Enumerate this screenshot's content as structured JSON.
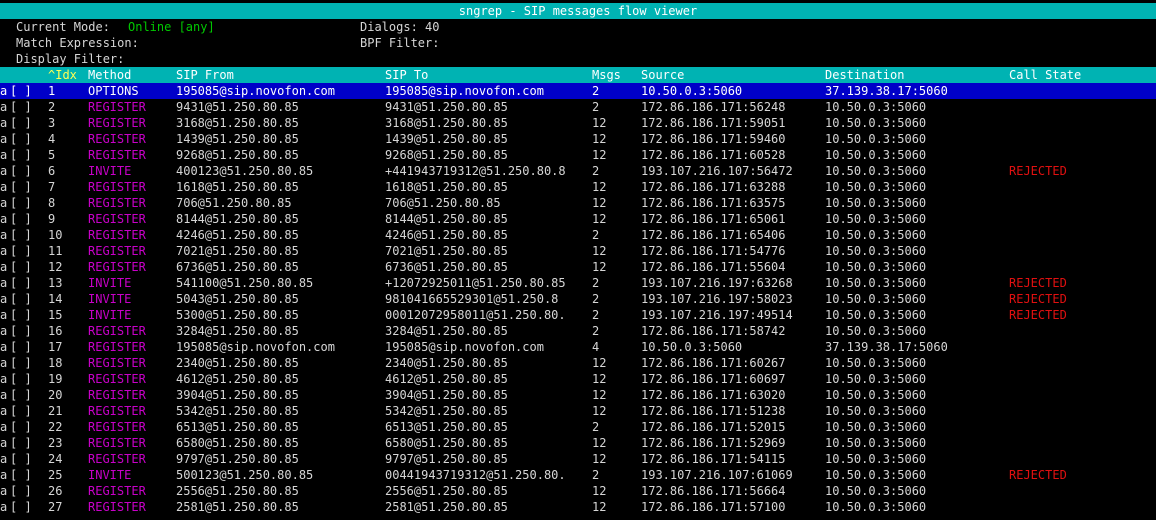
{
  "title": "sngrep - SIP messages flow viewer",
  "info": {
    "mode_label": "Current Mode:",
    "mode_value": "Online [any]",
    "dialogs_label": "Dialogs: 40",
    "match_label": "Match Expression:",
    "bpf_label": "BPF Filter:",
    "display_label": "Display Filter:"
  },
  "columns": {
    "idx": "^Idx",
    "method": "Method",
    "from": "SIP From",
    "to": "SIP To",
    "msgs": "Msgs",
    "source": "Source",
    "destination": "Destination",
    "state": "Call State"
  },
  "colors": {
    "header_bg": "#00b3b3",
    "selected_bg": "#0000c8",
    "method_color": "#c800c8",
    "rejected_color": "#e01010",
    "online_color": "#00c800"
  },
  "rows": [
    {
      "a": "a",
      "chk": "[ ]",
      "idx": "1",
      "method": "OPTIONS",
      "from": "195085@sip.novofon.com",
      "to": "195085@sip.novofon.com",
      "msgs": "2",
      "src": "10.50.0.3:5060",
      "dst": "37.139.38.17:5060",
      "state": ""
    },
    {
      "a": "a",
      "chk": "[ ]",
      "idx": "2",
      "method": "REGISTER",
      "from": "9431@51.250.80.85",
      "to": "9431@51.250.80.85",
      "msgs": "2",
      "src": "172.86.186.171:56248",
      "dst": "10.50.0.3:5060",
      "state": ""
    },
    {
      "a": "a",
      "chk": "[ ]",
      "idx": "3",
      "method": "REGISTER",
      "from": "3168@51.250.80.85",
      "to": "3168@51.250.80.85",
      "msgs": "12",
      "src": "172.86.186.171:59051",
      "dst": "10.50.0.3:5060",
      "state": ""
    },
    {
      "a": "a",
      "chk": "[ ]",
      "idx": "4",
      "method": "REGISTER",
      "from": "1439@51.250.80.85",
      "to": "1439@51.250.80.85",
      "msgs": "12",
      "src": "172.86.186.171:59460",
      "dst": "10.50.0.3:5060",
      "state": ""
    },
    {
      "a": "a",
      "chk": "[ ]",
      "idx": "5",
      "method": "REGISTER",
      "from": "9268@51.250.80.85",
      "to": "9268@51.250.80.85",
      "msgs": "12",
      "src": "172.86.186.171:60528",
      "dst": "10.50.0.3:5060",
      "state": ""
    },
    {
      "a": "a",
      "chk": "[ ]",
      "idx": "6",
      "method": "INVITE",
      "from": "400123@51.250.80.85",
      "to": "+441943719312@51.250.80.8",
      "msgs": "2",
      "src": "193.107.216.107:56472",
      "dst": "10.50.0.3:5060",
      "state": "REJECTED"
    },
    {
      "a": "a",
      "chk": "[ ]",
      "idx": "7",
      "method": "REGISTER",
      "from": "1618@51.250.80.85",
      "to": "1618@51.250.80.85",
      "msgs": "12",
      "src": "172.86.186.171:63288",
      "dst": "10.50.0.3:5060",
      "state": ""
    },
    {
      "a": "a",
      "chk": "[ ]",
      "idx": "8",
      "method": "REGISTER",
      "from": "706@51.250.80.85",
      "to": "706@51.250.80.85",
      "msgs": "12",
      "src": "172.86.186.171:63575",
      "dst": "10.50.0.3:5060",
      "state": ""
    },
    {
      "a": "a",
      "chk": "[ ]",
      "idx": "9",
      "method": "REGISTER",
      "from": "8144@51.250.80.85",
      "to": "8144@51.250.80.85",
      "msgs": "12",
      "src": "172.86.186.171:65061",
      "dst": "10.50.0.3:5060",
      "state": ""
    },
    {
      "a": "a",
      "chk": "[ ]",
      "idx": "10",
      "method": "REGISTER",
      "from": "4246@51.250.80.85",
      "to": "4246@51.250.80.85",
      "msgs": "2",
      "src": "172.86.186.171:65406",
      "dst": "10.50.0.3:5060",
      "state": ""
    },
    {
      "a": "a",
      "chk": "[ ]",
      "idx": "11",
      "method": "REGISTER",
      "from": "7021@51.250.80.85",
      "to": "7021@51.250.80.85",
      "msgs": "12",
      "src": "172.86.186.171:54776",
      "dst": "10.50.0.3:5060",
      "state": ""
    },
    {
      "a": "a",
      "chk": "[ ]",
      "idx": "12",
      "method": "REGISTER",
      "from": "6736@51.250.80.85",
      "to": "6736@51.250.80.85",
      "msgs": "12",
      "src": "172.86.186.171:55604",
      "dst": "10.50.0.3:5060",
      "state": ""
    },
    {
      "a": "a",
      "chk": "[ ]",
      "idx": "13",
      "method": "INVITE",
      "from": "541100@51.250.80.85",
      "to": "+12072925011@51.250.80.85",
      "msgs": "2",
      "src": "193.107.216.197:63268",
      "dst": "10.50.0.3:5060",
      "state": "REJECTED"
    },
    {
      "a": "a",
      "chk": "[ ]",
      "idx": "14",
      "method": "INVITE",
      "from": "5043@51.250.80.85",
      "to": "981041665529301@51.250.8",
      "msgs": "2",
      "src": "193.107.216.197:58023",
      "dst": "10.50.0.3:5060",
      "state": "REJECTED"
    },
    {
      "a": "a",
      "chk": "[ ]",
      "idx": "15",
      "method": "INVITE",
      "from": "5300@51.250.80.85",
      "to": "00012072958011@51.250.80.",
      "msgs": "2",
      "src": "193.107.216.197:49514",
      "dst": "10.50.0.3:5060",
      "state": "REJECTED"
    },
    {
      "a": "a",
      "chk": "[ ]",
      "idx": "16",
      "method": "REGISTER",
      "from": "3284@51.250.80.85",
      "to": "3284@51.250.80.85",
      "msgs": "2",
      "src": "172.86.186.171:58742",
      "dst": "10.50.0.3:5060",
      "state": ""
    },
    {
      "a": "a",
      "chk": "[ ]",
      "idx": "17",
      "method": "REGISTER",
      "from": "195085@sip.novofon.com",
      "to": "195085@sip.novofon.com",
      "msgs": "4",
      "src": "10.50.0.3:5060",
      "dst": "37.139.38.17:5060",
      "state": ""
    },
    {
      "a": "a",
      "chk": "[ ]",
      "idx": "18",
      "method": "REGISTER",
      "from": "2340@51.250.80.85",
      "to": "2340@51.250.80.85",
      "msgs": "12",
      "src": "172.86.186.171:60267",
      "dst": "10.50.0.3:5060",
      "state": ""
    },
    {
      "a": "a",
      "chk": "[ ]",
      "idx": "19",
      "method": "REGISTER",
      "from": "4612@51.250.80.85",
      "to": "4612@51.250.80.85",
      "msgs": "12",
      "src": "172.86.186.171:60697",
      "dst": "10.50.0.3:5060",
      "state": ""
    },
    {
      "a": "a",
      "chk": "[ ]",
      "idx": "20",
      "method": "REGISTER",
      "from": "3904@51.250.80.85",
      "to": "3904@51.250.80.85",
      "msgs": "12",
      "src": "172.86.186.171:63020",
      "dst": "10.50.0.3:5060",
      "state": ""
    },
    {
      "a": "a",
      "chk": "[ ]",
      "idx": "21",
      "method": "REGISTER",
      "from": "5342@51.250.80.85",
      "to": "5342@51.250.80.85",
      "msgs": "12",
      "src": "172.86.186.171:51238",
      "dst": "10.50.0.3:5060",
      "state": ""
    },
    {
      "a": "a",
      "chk": "[ ]",
      "idx": "22",
      "method": "REGISTER",
      "from": "6513@51.250.80.85",
      "to": "6513@51.250.80.85",
      "msgs": "2",
      "src": "172.86.186.171:52015",
      "dst": "10.50.0.3:5060",
      "state": ""
    },
    {
      "a": "a",
      "chk": "[ ]",
      "idx": "23",
      "method": "REGISTER",
      "from": "6580@51.250.80.85",
      "to": "6580@51.250.80.85",
      "msgs": "12",
      "src": "172.86.186.171:52969",
      "dst": "10.50.0.3:5060",
      "state": ""
    },
    {
      "a": "a",
      "chk": "[ ]",
      "idx": "24",
      "method": "REGISTER",
      "from": "9797@51.250.80.85",
      "to": "9797@51.250.80.85",
      "msgs": "12",
      "src": "172.86.186.171:54115",
      "dst": "10.50.0.3:5060",
      "state": ""
    },
    {
      "a": "a",
      "chk": "[ ]",
      "idx": "25",
      "method": "INVITE",
      "from": "500123@51.250.80.85",
      "to": "00441943719312@51.250.80.",
      "msgs": "2",
      "src": "193.107.216.107:61069",
      "dst": "10.50.0.3:5060",
      "state": "REJECTED"
    },
    {
      "a": "a",
      "chk": "[ ]",
      "idx": "26",
      "method": "REGISTER",
      "from": "2556@51.250.80.85",
      "to": "2556@51.250.80.85",
      "msgs": "12",
      "src": "172.86.186.171:56664",
      "dst": "10.50.0.3:5060",
      "state": ""
    },
    {
      "a": "a",
      "chk": "[ ]",
      "idx": "27",
      "method": "REGISTER",
      "from": "2581@51.250.80.85",
      "to": "2581@51.250.80.85",
      "msgs": "12",
      "src": "172.86.186.171:57100",
      "dst": "10.50.0.3:5060",
      "state": ""
    }
  ]
}
